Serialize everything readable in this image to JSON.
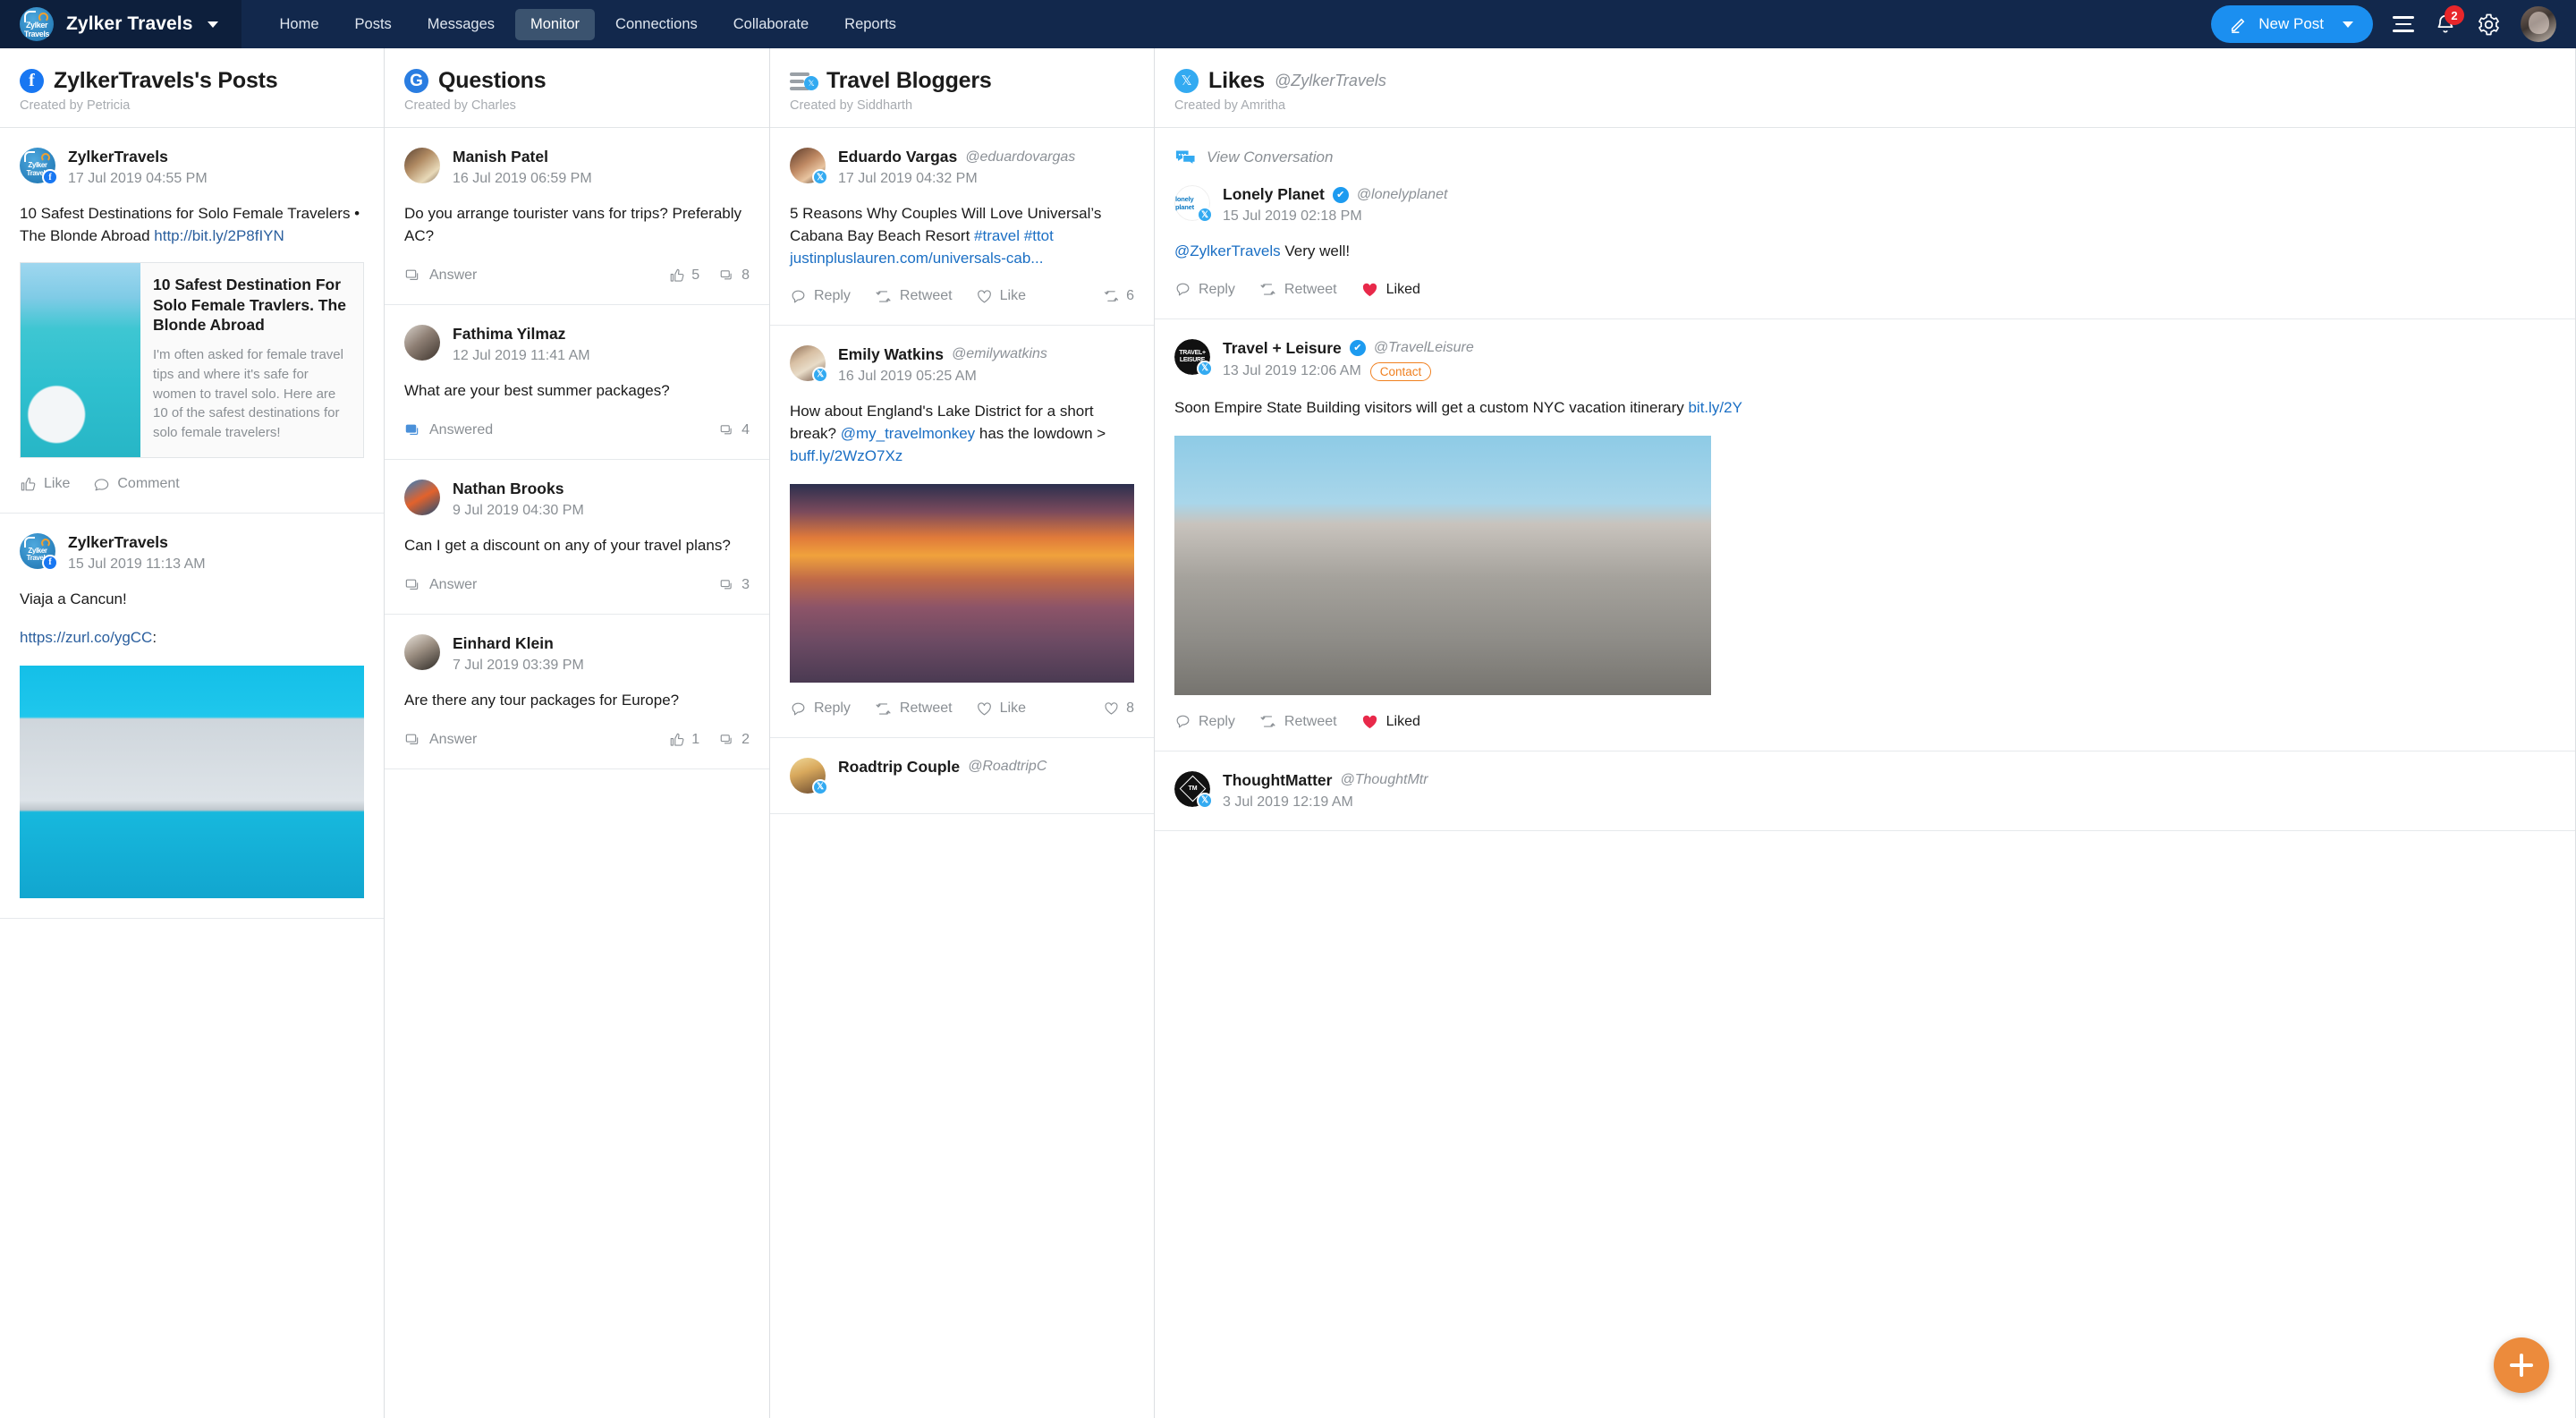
{
  "topbar": {
    "brand_name": "Zylker Travels",
    "brand_logo_text": "Zylker Travels",
    "nav": [
      {
        "label": "Home",
        "active": false
      },
      {
        "label": "Posts",
        "active": false
      },
      {
        "label": "Messages",
        "active": false
      },
      {
        "label": "Monitor",
        "active": true
      },
      {
        "label": "Connections",
        "active": false
      },
      {
        "label": "Collaborate",
        "active": false
      },
      {
        "label": "Reports",
        "active": false
      }
    ],
    "new_post_label": "New Post",
    "notification_count": "2",
    "accent_blue": "#1b8ff0",
    "bar_color": "#12284c",
    "badge_color": "#e8262a"
  },
  "columns": [
    {
      "id": "facebook-posts",
      "network": "facebook",
      "title": "ZylkerTravels's Posts",
      "handle": "",
      "created_by": "Created by Petricia",
      "posts": [
        {
          "author": "ZylkerTravels",
          "time": "17 Jul 2019 04:55 PM",
          "text_before": "10 Safest Destinations for Solo Female Travelers • The Blonde Abroad ",
          "link": "http://bit.ly/2P8fIYN",
          "preview_title": "10 Safest Destination For Solo Female Travlers. The Blonde Abroad",
          "preview_desc": "I'm often asked for female travel tips and where it's safe for women to travel solo. Here are 10 of the safest destinations for solo female travelers!",
          "action_like": "Like",
          "action_comment": "Comment"
        },
        {
          "author": "ZylkerTravels",
          "time": "15 Jul 2019 11:13 AM",
          "text_before": "Viaja a Cancun!",
          "link": "https://zurl.co/ygCC",
          "link_suffix": ":"
        }
      ]
    },
    {
      "id": "questions",
      "network": "google",
      "title": "Questions",
      "handle": "",
      "created_by": "Created by Charles",
      "questions": [
        {
          "author": "Manish Patel",
          "time": "16 Jul 2019 06:59 PM",
          "text": "Do you arrange tourister vans for trips? Preferably AC?",
          "answer_label": "Answer",
          "likes": "5",
          "comments": "8"
        },
        {
          "author": "Fathima Yilmaz",
          "time": "12 Jul 2019 11:41 AM",
          "text": "What are your best summer packages?",
          "answer_label": "Answered",
          "likes": "",
          "comments": "4"
        },
        {
          "author": "Nathan Brooks",
          "time": "9 Jul 2019 04:30 PM",
          "text": "Can I get a discount on any of your travel plans?",
          "answer_label": "Answer",
          "likes": "",
          "comments": "3"
        },
        {
          "author": "Einhard Klein",
          "time": "7 Jul 2019 03:39 PM",
          "text": "Are there any tour packages for Europe?",
          "answer_label": "Answer",
          "likes": "1",
          "comments": "2"
        }
      ]
    },
    {
      "id": "travel-bloggers",
      "network": "twitter-list",
      "title": "Travel Bloggers",
      "handle": "",
      "created_by": "Created by Siddharth",
      "tweets": [
        {
          "author": "Eduardo Vargas",
          "handle": "@eduardovargas",
          "time": "17 Jul 2019 04:32 PM",
          "text": "5 Reasons Why Couples Will Love Universal’s Cabana Bay Beach Resort ",
          "hashtags": "#travel #ttot",
          "link": "justinpluslauren.com/universals-cab...",
          "reply": "Reply",
          "retweet": "Retweet",
          "like": "Like",
          "retweet_count": "6"
        },
        {
          "author": "Emily Watkins",
          "handle": "@emilywatkins",
          "time": "16 Jul 2019 05:25 AM",
          "text": "How about England's Lake District for a short break? ",
          "mention": "@my_travelmonkey",
          "text_after": " has the lowdown > ",
          "link": "buff.ly/2WzO7Xz",
          "reply": "Reply",
          "retweet": "Retweet",
          "like": "Like",
          "like_count": "8"
        },
        {
          "author": "Roadtrip Couple",
          "handle": "@RoadtripC",
          "time": "",
          "text": ""
        }
      ]
    },
    {
      "id": "likes",
      "network": "twitter",
      "title": "Likes",
      "handle": "@ZylkerTravels",
      "created_by": "Created by Amritha",
      "view_conversation": "View Conversation",
      "tweets": [
        {
          "author": "Lonely Planet",
          "handle": "@lonelyplanet",
          "verified": true,
          "time": "15 Jul 2019 02:18 PM",
          "mention": "@ZylkerTravels",
          "text": " Very well!",
          "reply": "Reply",
          "retweet": "Retweet",
          "like": "Liked"
        },
        {
          "author": "Travel + Leisure",
          "handle": "@TravelLeisure",
          "verified": true,
          "time": "13 Jul 2019 12:06 AM",
          "badge": "Contact",
          "text": "Soon Empire State Building visitors will get a custom NYC vacation itinerary ",
          "link": "bit.ly/2Y",
          "reply": "Reply",
          "retweet": "Retweet",
          "like": "Liked"
        },
        {
          "author": "ThoughtMatter",
          "handle": "@ThoughtMtr",
          "time": "3 Jul 2019 12:19 AM"
        }
      ]
    }
  ],
  "fab": {
    "label": "+",
    "color": "#ec8b3c"
  }
}
